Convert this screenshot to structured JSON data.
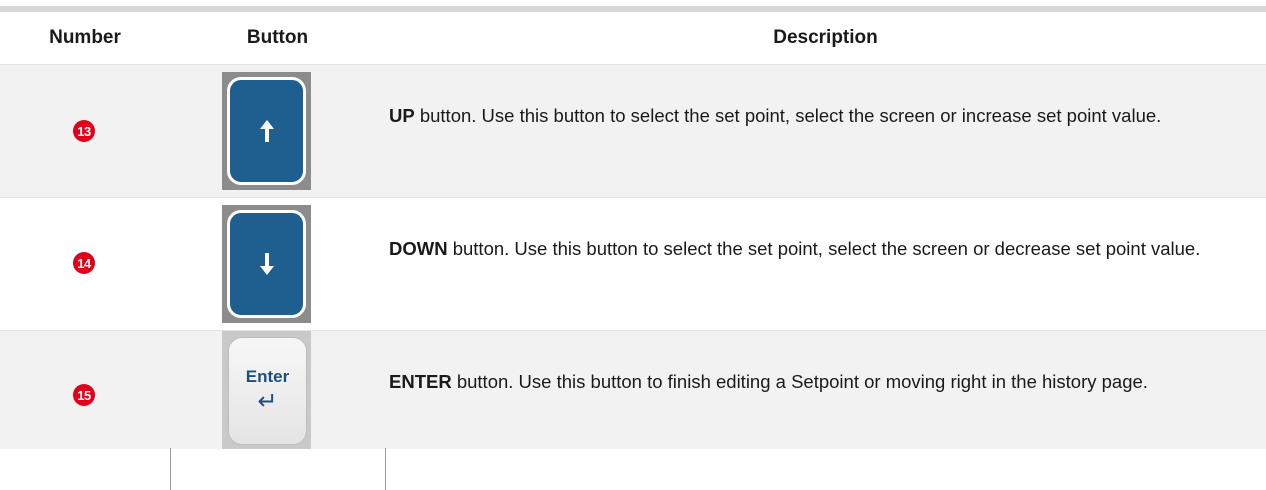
{
  "header": {
    "number": "Number",
    "button": "Button",
    "description": "Description"
  },
  "rows": [
    {
      "number": "13",
      "key_icon": "arrow-up-icon",
      "key_name": "UP",
      "description": " button. Use this button to select the set point, select the screen or increase set point value."
    },
    {
      "number": "14",
      "key_icon": "arrow-down-icon",
      "key_name": "DOWN",
      "description": " button. Use this button to select the set point, select the screen or  decrease set point value."
    },
    {
      "number": "15",
      "key_label": "Enter",
      "key_icon": "enter-arrow-icon",
      "key_name": "ENTER",
      "description": " button. Use this button to finish editing a Setpoint or moving right in the history page."
    }
  ],
  "colors": {
    "badge": "#e0001a",
    "key_blue": "#1e5f90",
    "enter_text": "#1f4e79",
    "row_alt": "#f2f2f2"
  }
}
